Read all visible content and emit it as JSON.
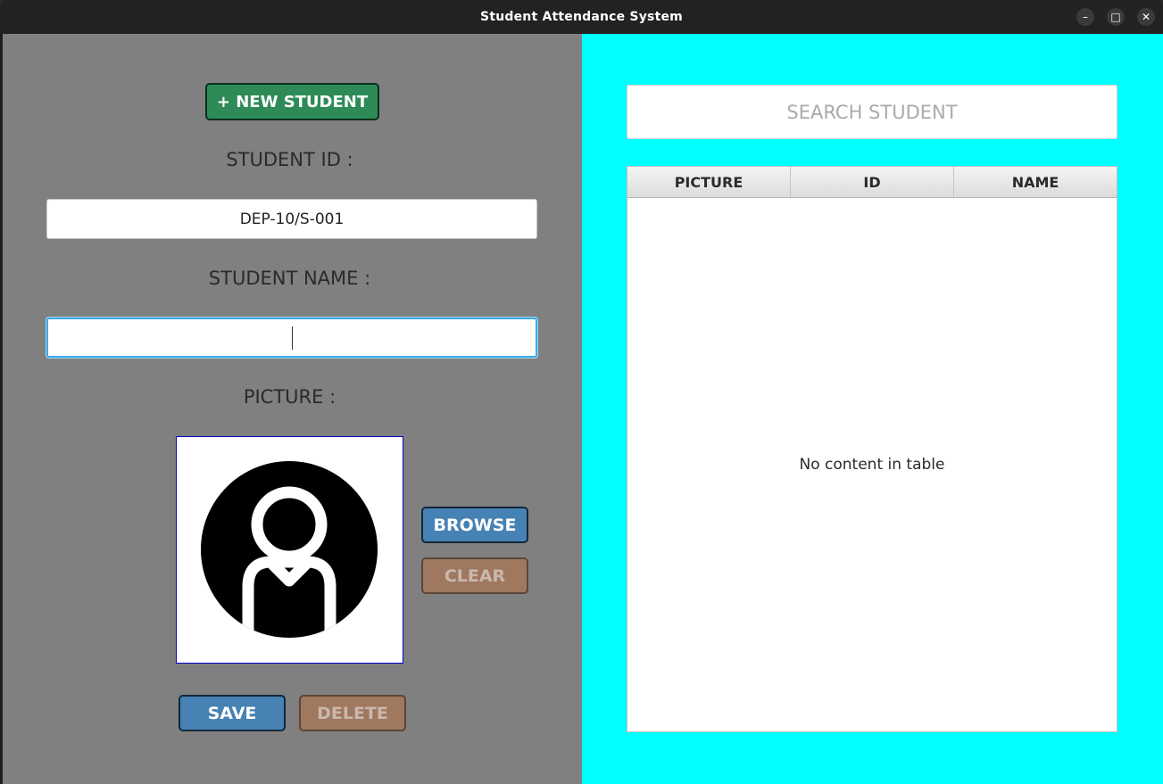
{
  "window": {
    "title": "Student Attendance System",
    "controls": {
      "minimize": "–",
      "maximize": "□",
      "close": "✕"
    }
  },
  "form": {
    "new_student_button": "+ NEW STUDENT",
    "student_id_label": "STUDENT ID :",
    "student_id_value": "DEP-10/S-001",
    "student_name_label": "STUDENT NAME :",
    "student_name_value": "",
    "picture_label": "PICTURE :",
    "picture_icon": "user-avatar-icon",
    "browse_button": "BROWSE",
    "clear_button": "CLEAR",
    "save_button": "SAVE",
    "delete_button": "DELETE"
  },
  "list": {
    "search_placeholder": "SEARCH STUDENT",
    "columns": [
      "PICTURE",
      "ID",
      "NAME"
    ],
    "rows": [],
    "empty_message": "No content in table"
  },
  "colors": {
    "left_background": "#808080",
    "right_background": "#00ffff",
    "new_button": "#2e8b57",
    "primary_button": "#4682b4",
    "secondary_button": "#a0785f"
  }
}
